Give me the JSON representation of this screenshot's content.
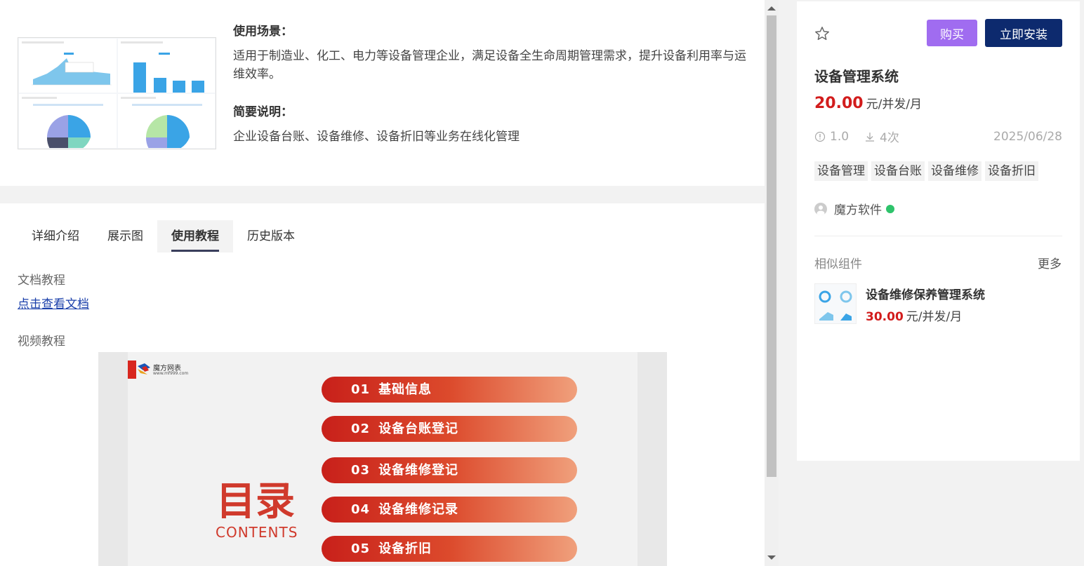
{
  "product": {
    "scene_heading": "使用场景：",
    "scene_text": "适用于制造业、化工、电力等设备管理企业，满足设备全生命周期管理需求，提升设备利用率与运维效率。",
    "brief_heading": "简要说明：",
    "brief_text": "企业设备台账、设备维修、设备折旧等业务在线化管理"
  },
  "tabs": [
    {
      "label": "详细介绍",
      "active": false
    },
    {
      "label": "展示图",
      "active": false
    },
    {
      "label": "使用教程",
      "active": true
    },
    {
      "label": "历史版本",
      "active": false
    }
  ],
  "tutorial": {
    "doc_heading": "文档教程",
    "doc_link": "点击查看文档",
    "video_heading": "视频教程"
  },
  "video_slide": {
    "logo_text": "魔方网表",
    "logo_url": "www.mf999.com",
    "title": "目录",
    "subtitle": "CONTENTS",
    "items": [
      {
        "num": "01",
        "label": "基础信息"
      },
      {
        "num": "02",
        "label": "设备台账登记"
      },
      {
        "num": "03",
        "label": "设备维修登记"
      },
      {
        "num": "04",
        "label": "设备维修记录"
      },
      {
        "num": "05",
        "label": "设备折旧"
      }
    ]
  },
  "sidebar": {
    "buy_label": "购买",
    "install_label": "立即安装",
    "title": "设备管理系统",
    "price": "20.00",
    "price_unit": "元/并发/月",
    "version": "1.0",
    "downloads": "4次",
    "date": "2025/06/28",
    "tags": [
      "设备管理",
      "设备台账",
      "设备维修",
      "设备折旧"
    ],
    "vendor": "魔方软件",
    "similar_heading": "相似组件",
    "more_label": "更多",
    "similar": {
      "name": "设备维修保养管理系统",
      "price": "30.00",
      "price_unit": "元/并发/月"
    }
  },
  "colors": {
    "accent_purple": "#a06cf0",
    "install_navy": "#0d2a6e",
    "price_red": "#d21c1c",
    "link_blue": "#1a3faa",
    "verify_green": "#2ec36b"
  }
}
